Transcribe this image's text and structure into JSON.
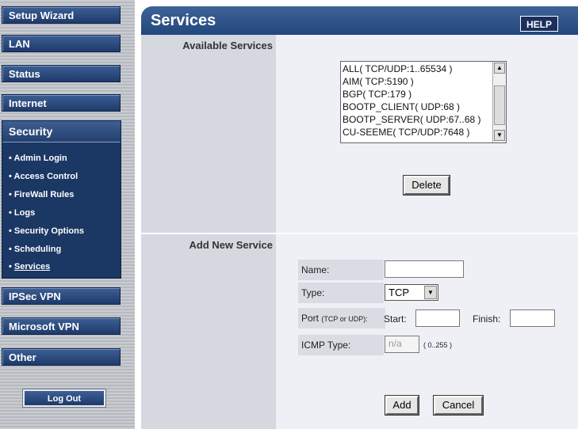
{
  "sidebar": {
    "nav": {
      "setup_wizard": "Setup Wizard",
      "lan": "LAN",
      "status": "Status",
      "internet": "Internet",
      "security": "Security",
      "ipsec_vpn": "IPSec VPN",
      "microsoft_vpn": "Microsoft VPN",
      "other": "Other"
    },
    "security_items": [
      "Admin Login",
      "Access Control",
      "FireWall Rules",
      "Logs",
      "Security Options",
      "Scheduling",
      "Services"
    ],
    "active_item": "Services",
    "logout_label": "Log Out"
  },
  "header": {
    "title": "Services",
    "help_label": "HELP"
  },
  "available": {
    "label": "Available Services",
    "services": [
      "ALL( TCP/UDP:1..65534 )",
      "AIM( TCP:5190 )",
      "BGP( TCP:179 )",
      "BOOTP_CLIENT( UDP:68 )",
      "BOOTP_SERVER( UDP:67..68 )",
      "CU-SEEME( TCP/UDP:7648 )"
    ],
    "delete_label": "Delete"
  },
  "add_service": {
    "label": "Add New Service",
    "name_label": "Name:",
    "name_value": "",
    "type_label": "Type:",
    "type_value": "TCP",
    "port_label": "Port",
    "port_hint": "(TCP or UDP):",
    "start_label": "Start:",
    "start_value": "",
    "finish_label": "Finish:",
    "finish_value": "",
    "icmp_label": "ICMP Type:",
    "icmp_placeholder": "n/a",
    "icmp_range": "( 0..255 )",
    "add_label": "Add",
    "cancel_label": "Cancel"
  },
  "colors": {
    "nav_blue": "#1e3a6b",
    "header_blue": "#21477c",
    "label_bg": "#d6d8e0",
    "panel_bg": "#eef0f6"
  }
}
